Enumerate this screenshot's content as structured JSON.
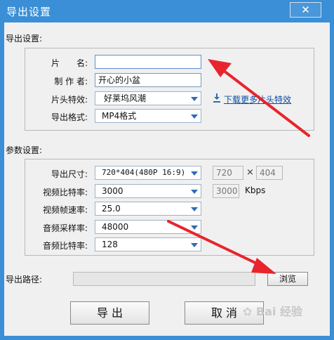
{
  "window": {
    "title": "导出设置",
    "close_glyph": "✕"
  },
  "export_section": {
    "title": "导出设置:",
    "fields": {
      "name_label": "片　　名:",
      "name_value": "",
      "author_label": "制 作 者:",
      "author_value": "开心的小盆",
      "intro_effect_label": "片头特效:",
      "intro_effect_value": "好莱坞风潮",
      "download_link": "下载更多片头特效",
      "format_label": "导出格式:",
      "format_value": "MP4格式"
    }
  },
  "params_section": {
    "title": "参数设置:",
    "size_label": "导出尺寸:",
    "size_value": "720*404(480P 16:9)",
    "width_value": "720",
    "times_glyph": "×",
    "height_value": "404",
    "video_bitrate_label": "视频比特率:",
    "video_bitrate_value": "3000",
    "video_bitrate_input": "3000",
    "video_bitrate_unit": "Kbps",
    "frame_rate_label": "视频帧速率:",
    "frame_rate_value": "25.0",
    "sample_rate_label": "音频采样率:",
    "sample_rate_value": "48000",
    "audio_bitrate_label": "音频比特率:",
    "audio_bitrate_value": "128"
  },
  "path": {
    "label": "导出路径:",
    "value": "",
    "browse_label": "浏览"
  },
  "footer": {
    "export_label": "导 出",
    "cancel_label": "取 消"
  },
  "watermark": {
    "text": "Bai 经验"
  },
  "colors": {
    "titlebar": "#3a8fd6",
    "annotation_arrow": "#e8242c",
    "link": "#0b4ea2"
  }
}
